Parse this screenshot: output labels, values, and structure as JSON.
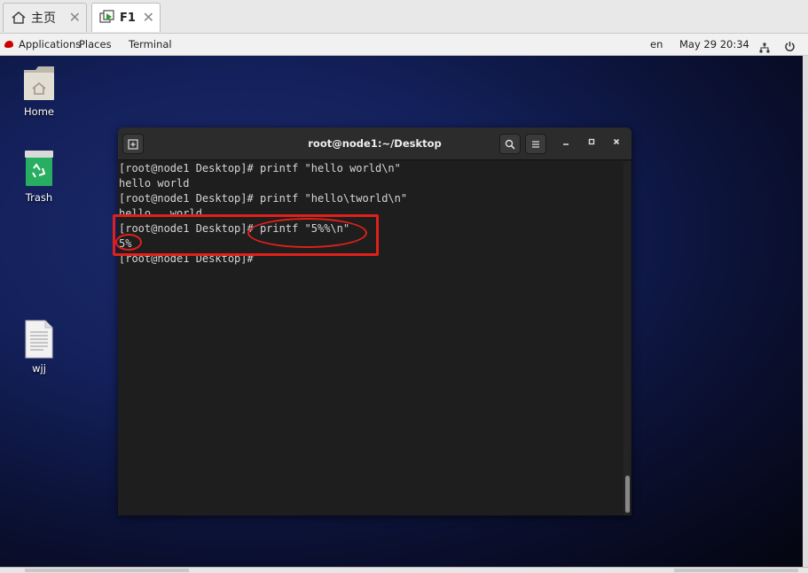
{
  "host_tabs": [
    {
      "label": "主页",
      "icon": "home-icon"
    },
    {
      "label": "F1",
      "icon": "vm-icon"
    }
  ],
  "panel": {
    "applications": "Applications",
    "places": "Places",
    "terminal": "Terminal",
    "lang": "en",
    "datetime": "May 29  20:34"
  },
  "desktop_icons": [
    {
      "label": "Home",
      "icon": "folder-home-icon"
    },
    {
      "label": "Trash",
      "icon": "trash-icon"
    },
    {
      "label": "wjj",
      "icon": "text-file-icon"
    }
  ],
  "terminal": {
    "title": "root@node1:~/Desktop",
    "lines": [
      "[root@node1 Desktop]# printf \"hello world\\n\"",
      "hello world",
      "[root@node1 Desktop]# printf \"hello\\tworld\\n\"",
      "hello   world",
      "[root@node1 Desktop]# printf \"5%%\\n\"",
      "5%",
      "[root@node1 Desktop]# "
    ]
  },
  "colors": {
    "annotation": "#e0201a",
    "terminal_bg": "#1e1e1e",
    "desktop_bg": "#13205a"
  }
}
